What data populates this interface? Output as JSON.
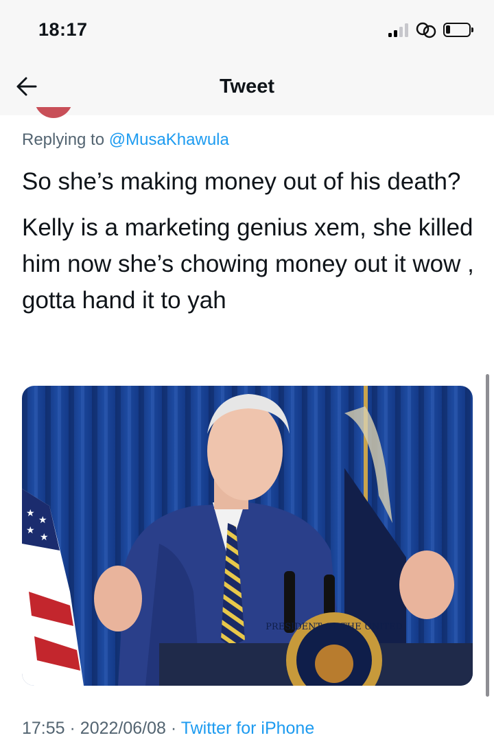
{
  "status_bar": {
    "time": "18:17",
    "icons": [
      "signal-icon",
      "link-icon",
      "battery-icon"
    ]
  },
  "nav": {
    "title": "Tweet",
    "back_icon": "arrow-left-icon"
  },
  "tweet": {
    "replying_prefix": "Replying to",
    "replying_handle": "@MusaKhawula",
    "paragraph_1": "So she’s making money out of his death?",
    "paragraph_2": "Kelly is a marketing genius xem, she killed him now she’s chowing money out it wow , gotta hand it to yah",
    "media_seal_text": "PRESIDENT OF THE UNITED",
    "time": "17:55",
    "separator": "·",
    "date": "2022/06/08",
    "source": "Twitter for iPhone"
  },
  "colors": {
    "link_blue": "#1d9bf0",
    "secondary_text": "#536471",
    "bar_background": "#f7f7f7"
  }
}
